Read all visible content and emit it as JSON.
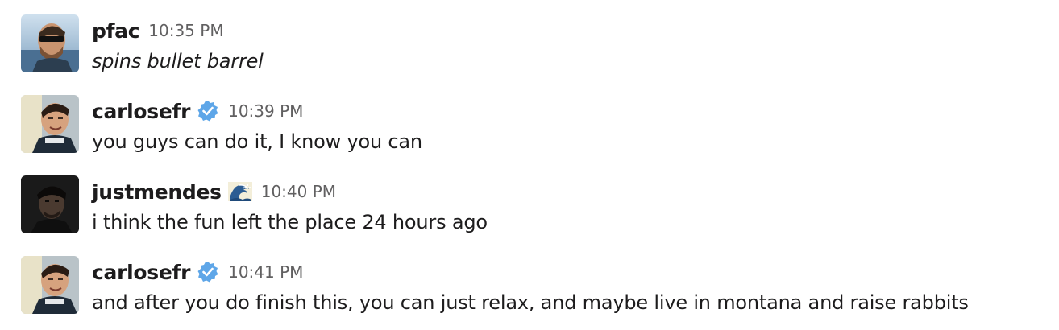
{
  "messages": [
    {
      "username": "pfac",
      "timestamp": "10:35 PM",
      "text": "spins bullet barrel",
      "avatar": "avatar-pfac",
      "verified": false,
      "status_icon": ""
    },
    {
      "username": "carlosefr",
      "timestamp": "10:39 PM",
      "text": "you guys can do it, I know you can",
      "avatar": "avatar-carlosefr",
      "verified": true,
      "status_icon": "verified-badge-icon"
    },
    {
      "username": "justmendes",
      "timestamp": "10:40 PM",
      "text": "i think the fun left the place 24 hours ago",
      "avatar": "avatar-justmendes",
      "verified": false,
      "status_icon": "wave-emoji-icon"
    },
    {
      "username": "carlosefr",
      "timestamp": "10:41 PM",
      "text": "and after you do finish this, you can just relax, and maybe live in montana and raise rabbits",
      "avatar": "avatar-carlosefr",
      "verified": true,
      "status_icon": "verified-badge-icon"
    }
  ],
  "colors": {
    "username": "#1d1c1d",
    "timestamp": "#616061",
    "verified_badge": "#5ea6e8",
    "background": "#ffffff"
  }
}
